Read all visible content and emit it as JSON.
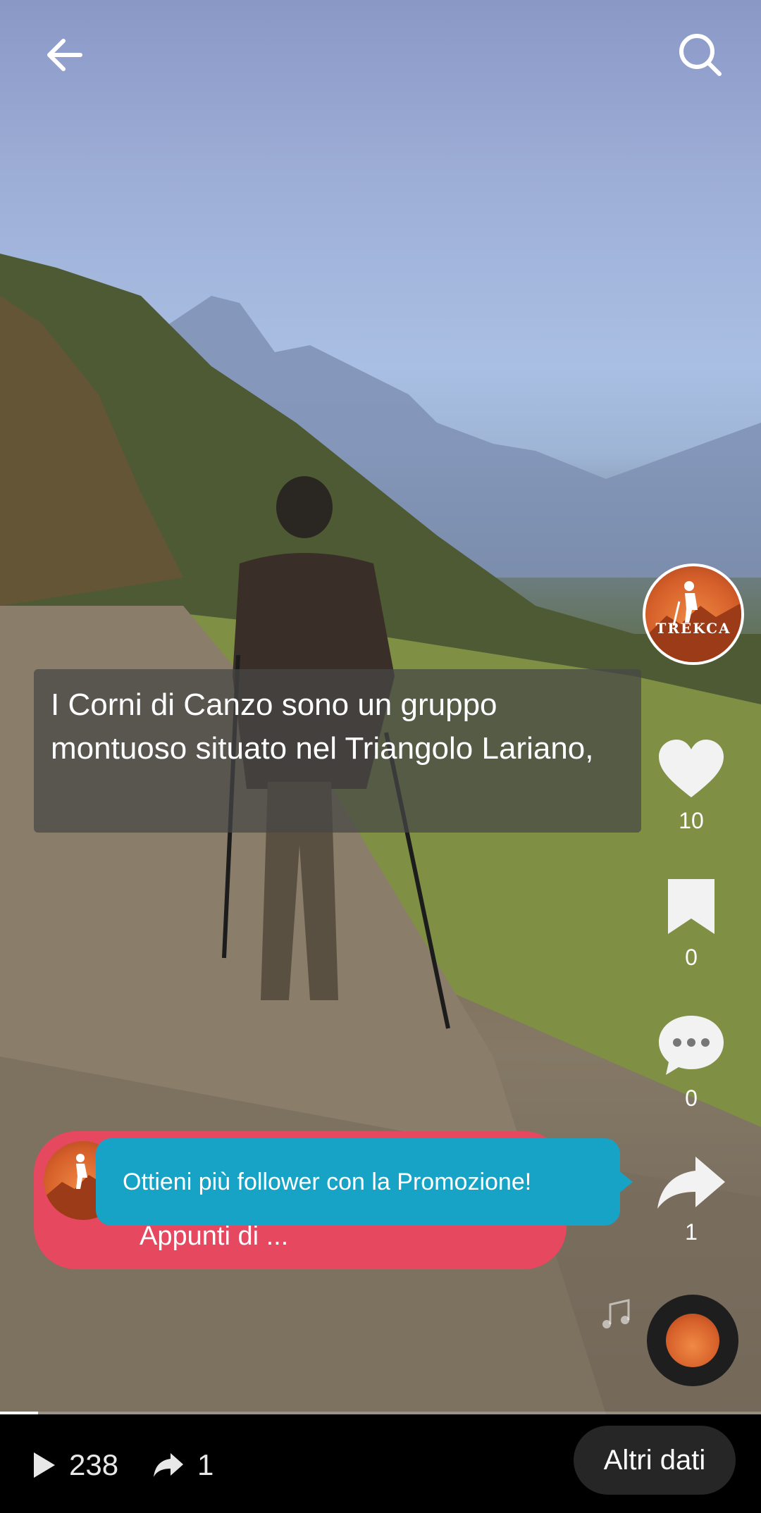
{
  "header": {
    "back_icon": "arrow-left-icon",
    "search_icon": "search-icon"
  },
  "video": {
    "caption": "I Corni di Canzo sono un gruppo montuoso situato nel Triangolo Lariano,",
    "progress_fraction": 0.05
  },
  "side": {
    "avatar_text": "TREKCA",
    "likes": "10",
    "saves": "0",
    "comments": "0",
    "shares": "1"
  },
  "promo": {
    "tooltip": "Ottieni più follower con la Promozione!",
    "subtitle": "Appunti di ..."
  },
  "bottom": {
    "views": "238",
    "shares": "1",
    "more_label": "Altri dati"
  },
  "colors": {
    "tooltip": "#17a3c5",
    "promo_pill": "#e5485f"
  }
}
